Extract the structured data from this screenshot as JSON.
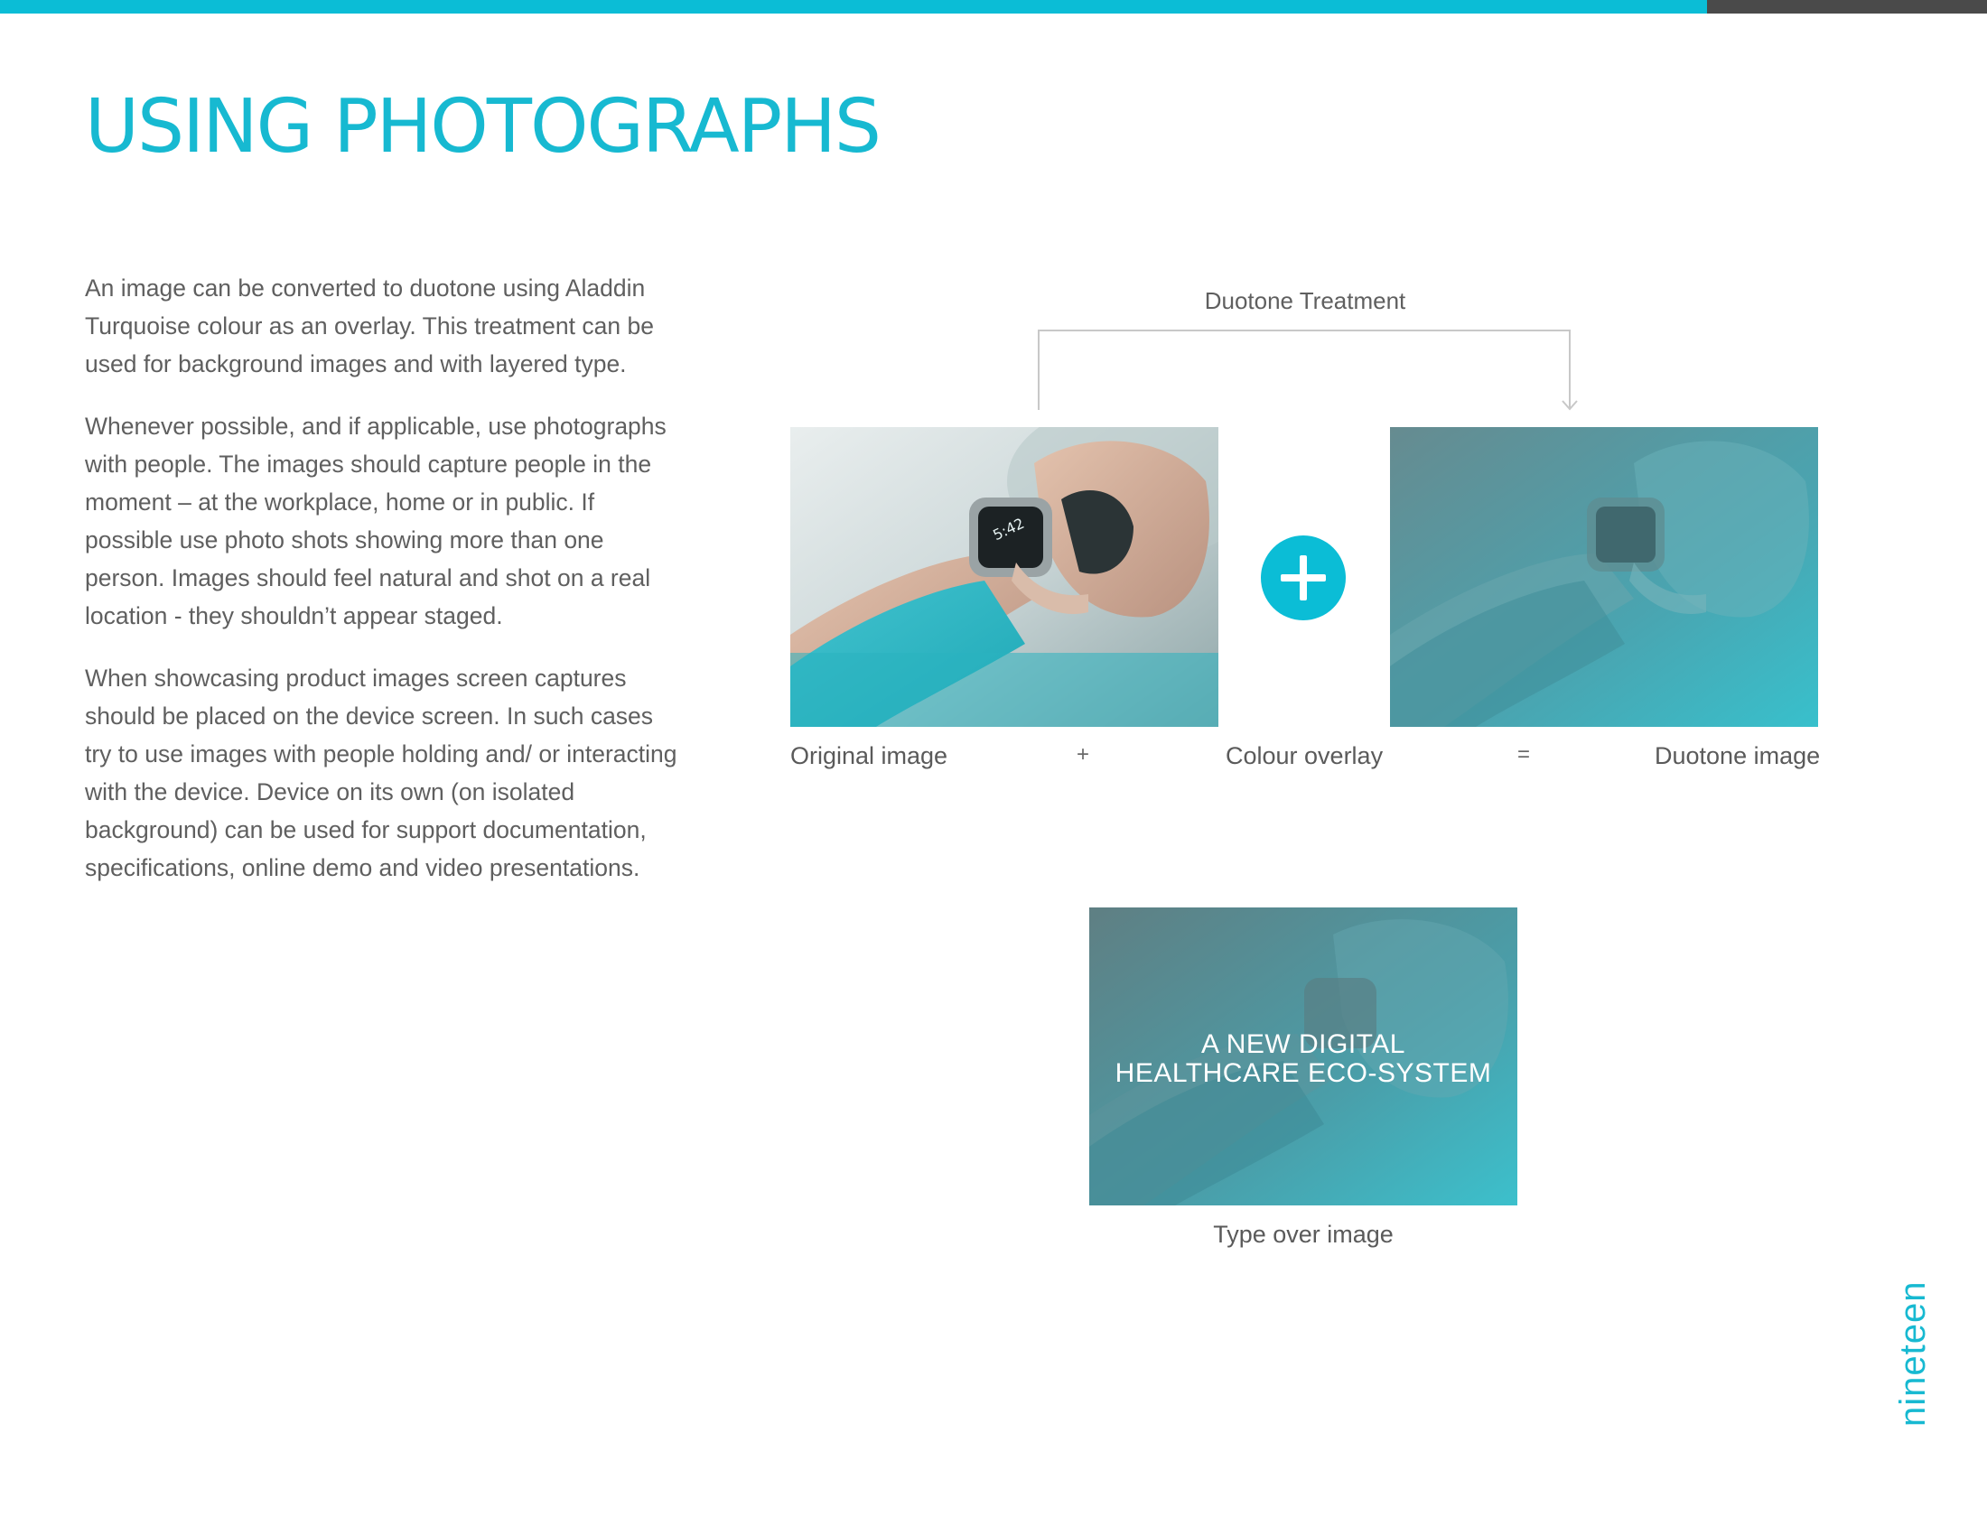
{
  "page": {
    "title": "USING PHOTOGRAPHS",
    "page_number": "nineteen",
    "colors": {
      "accent": "#0bbdd6",
      "title": "#17b9d1",
      "dark_bar": "#4a4a4a",
      "text": "#5f5f5f"
    }
  },
  "body": {
    "paragraphs": [
      "An image can be converted to duotone using Aladdin Turquoise colour as an overlay. This treatment can be used for background images and with layered type.",
      "Whenever possible, and if applicable, use photographs with people. The images should capture people in the moment – at the workplace, home or in public. If possible use photo shots showing more than one person. Images should feel natural and shot on a real location - they shouldn’t appear staged.",
      "When showcasing product images screen captures should be placed on the device screen. In such cases try to use images with people holding and/ or interacting with the device. Device on its own (on isolated background) can be used for support documentation, specifications, online demo and video presentations."
    ]
  },
  "diagram": {
    "bracket_label": "Duotone Treatment",
    "captions": {
      "original": "Original image",
      "plus": "+",
      "overlay": "Colour overlay",
      "equals": "=",
      "duotone": "Duotone image",
      "type_over": "Type over image"
    },
    "overlay_headline": [
      "A NEW DIGITAL",
      "HEALTHCARE ECO-SYSTEM"
    ],
    "watch_time": "5:42",
    "icons": [
      "plus-icon",
      "arrow-down-icon"
    ]
  }
}
